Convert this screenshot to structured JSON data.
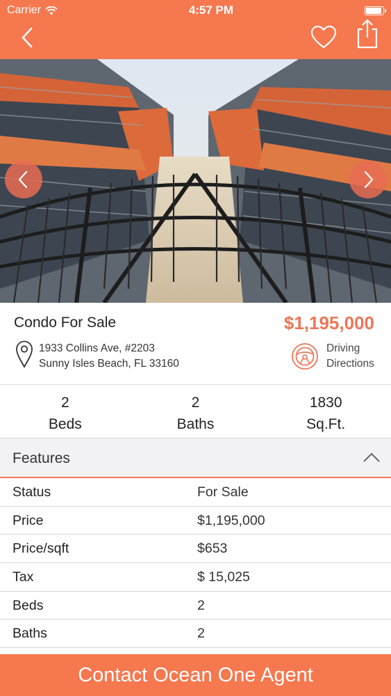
{
  "status_bar": {
    "carrier": "Carrier",
    "time": "4:57 PM"
  },
  "nav": {
    "back_icon": "chevron-left-icon",
    "favorite_icon": "heart-icon",
    "share_icon": "share-icon"
  },
  "listing": {
    "type": "Condo For Sale",
    "price": "$1,195,000",
    "address_line1": "1933 Collins Ave, #2203",
    "address_line2": "Sunny Isles Beach, FL 33160",
    "directions_line1": "Driving",
    "directions_line2": "Directions"
  },
  "stats": [
    {
      "value": "2",
      "label": "Beds"
    },
    {
      "value": "2",
      "label": "Baths"
    },
    {
      "value": "1830",
      "label": "Sq.Ft."
    }
  ],
  "features": {
    "title": "Features",
    "rows": [
      {
        "label": "Status",
        "value": "For Sale"
      },
      {
        "label": "Price",
        "value": "$1,195,000"
      },
      {
        "label": "Price/sqft",
        "value": "$653"
      },
      {
        "label": "Tax",
        "value": "$ 15,025"
      },
      {
        "label": "Beds",
        "value": "2"
      },
      {
        "label": "Baths",
        "value": "2"
      }
    ]
  },
  "cta": {
    "label": "Contact Ocean One Agent"
  },
  "colors": {
    "accent": "#f5784f",
    "price": "#ec7657",
    "header_bg": "#f2f2f4"
  }
}
